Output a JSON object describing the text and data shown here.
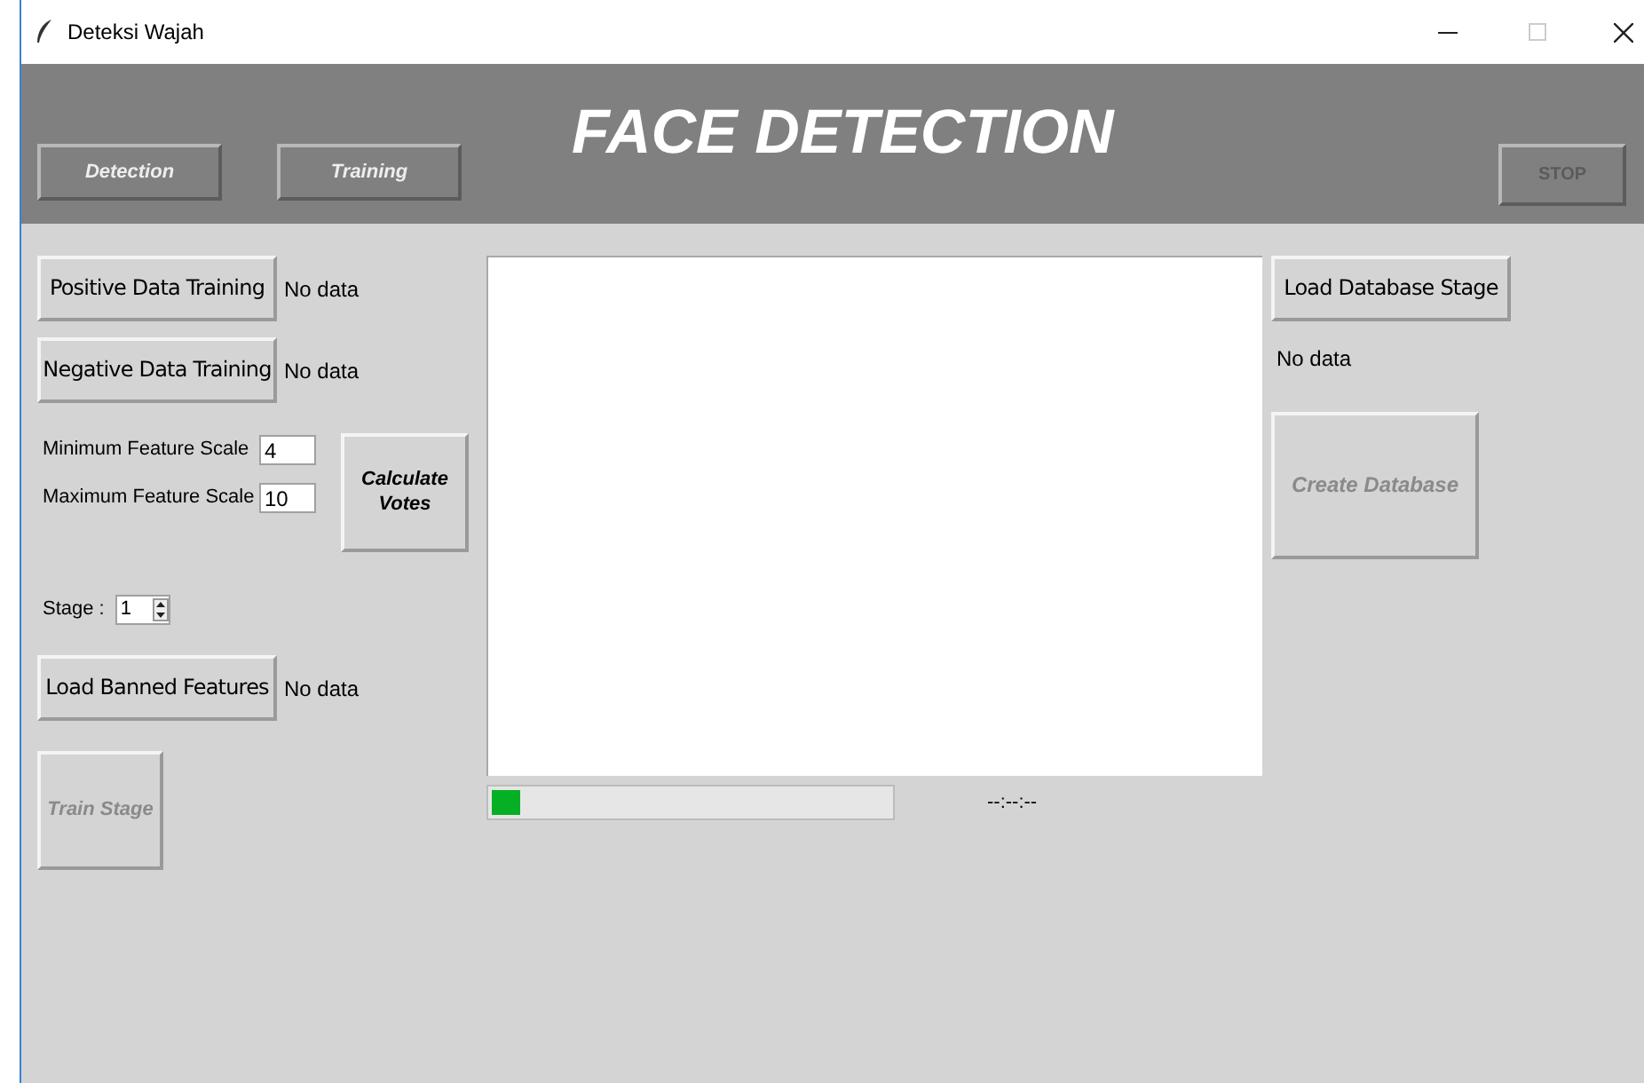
{
  "window": {
    "title": "Deteksi Wajah"
  },
  "header": {
    "title": "FACE DETECTION",
    "nav_buttons": [
      {
        "label": "Detection",
        "disabled": false
      },
      {
        "label": "Training",
        "disabled": false
      }
    ],
    "stop_button": {
      "label": "STOP",
      "disabled": true
    }
  },
  "training": {
    "positive": {
      "label": "Positive Data Training",
      "status": "No data"
    },
    "negative": {
      "label": "Negative Data Training",
      "status": "No data"
    },
    "min_scale": {
      "label": "Minimum Feature Scale",
      "value": "4"
    },
    "max_scale": {
      "label": "Maximum Feature Scale",
      "value": "10"
    },
    "calculate_button": {
      "label": "Calculate Votes",
      "disabled": false
    },
    "stage": {
      "label": "Stage :",
      "value": "1"
    },
    "banned": {
      "label": "Load Banned Features",
      "status": "No data"
    },
    "train_button": {
      "label": "Train Stage",
      "disabled": true
    }
  },
  "progress": {
    "level": 0.07,
    "time": "--:--:--"
  },
  "database": {
    "load_button": {
      "label": "Load Database Stage"
    },
    "status": "No data",
    "create_button": {
      "label": "Create Database",
      "disabled": true
    }
  }
}
